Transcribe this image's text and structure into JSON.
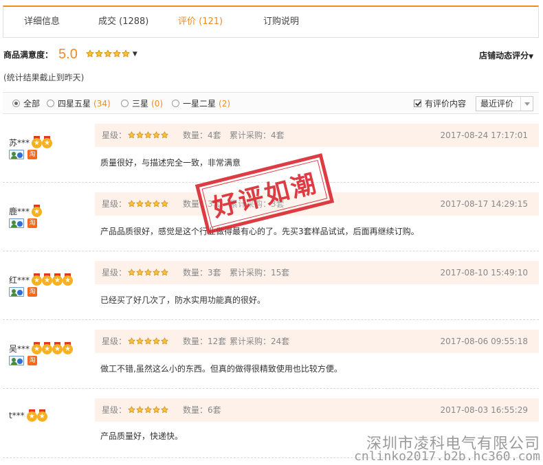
{
  "tabs": [
    {
      "label": "详细信息",
      "active": false
    },
    {
      "label": "成交 (1288)",
      "active": false
    },
    {
      "label": "评价 (121)",
      "active": true
    },
    {
      "label": "订购说明",
      "active": false
    }
  ],
  "satisfaction": {
    "label": "商品满意度：",
    "score": "5.0",
    "stars": 5,
    "shop_rating_label": "店铺动态评分",
    "note": "(统计结果截止到昨天)"
  },
  "filters": {
    "options": [
      {
        "label": "全部",
        "count": "",
        "selected": true
      },
      {
        "label": "四星五星",
        "count": "(34)",
        "selected": false
      },
      {
        "label": "三星",
        "count": "(0)",
        "selected": false
      },
      {
        "label": "一星二星",
        "count": "(2)",
        "selected": false
      }
    ],
    "has_content_label": "有评价内容",
    "has_content_checked": true,
    "sort_label": "最近评价"
  },
  "reviews": [
    {
      "user": "苏***",
      "medals": 2,
      "star_label": "星级：",
      "stars": 5,
      "qty": "数量：4套",
      "total": "累计采购：4套",
      "time": "2017-08-24 17:17:01",
      "content": "质量很好，与描述完全一致，非常满意"
    },
    {
      "user": "鹿***",
      "medals": 1,
      "star_label": "星级：",
      "stars": 5,
      "qty": "数量：3套",
      "total": "累计采购：3套",
      "time": "2017-08-17 14:29:15",
      "content": "产品品质很好，感觉是这个行业做得最有心的了。先买3套样品试试，后面再继续订购。"
    },
    {
      "user": "红***",
      "medals": 4,
      "star_label": "星级：",
      "stars": 5,
      "qty": "数量：3套",
      "total": "累计采购：15套",
      "time": "2017-08-10 15:49:10",
      "content": "已经买了好几次了，防水实用功能真的很好。"
    },
    {
      "user": "吴***",
      "medals": 4,
      "star_label": "星级：",
      "stars": 5,
      "qty": "数量：12套",
      "total": "累计采购：24套",
      "time": "2017-08-06 09:55:18",
      "content": "做工不错,虽然这么小的东西。但真的做得很精致使用也比较方便。"
    },
    {
      "user": "t***",
      "medals": 2,
      "star_label": "星级：",
      "stars": 5,
      "qty": "数量：6套",
      "total": "",
      "time": "2017-08-03 16:55:29",
      "content": "产品质量好，快递快。"
    }
  ],
  "stamp_text": "好评如潮",
  "watermark": {
    "line1": "深圳市凌科电气有限公司",
    "line2": "cnlinko2017.b2b.hc360.com"
  },
  "colors": {
    "accent": "#f08a24",
    "star": "#f7b021",
    "stamp": "#d8222a",
    "meta_bg": "#fdf1ea"
  }
}
